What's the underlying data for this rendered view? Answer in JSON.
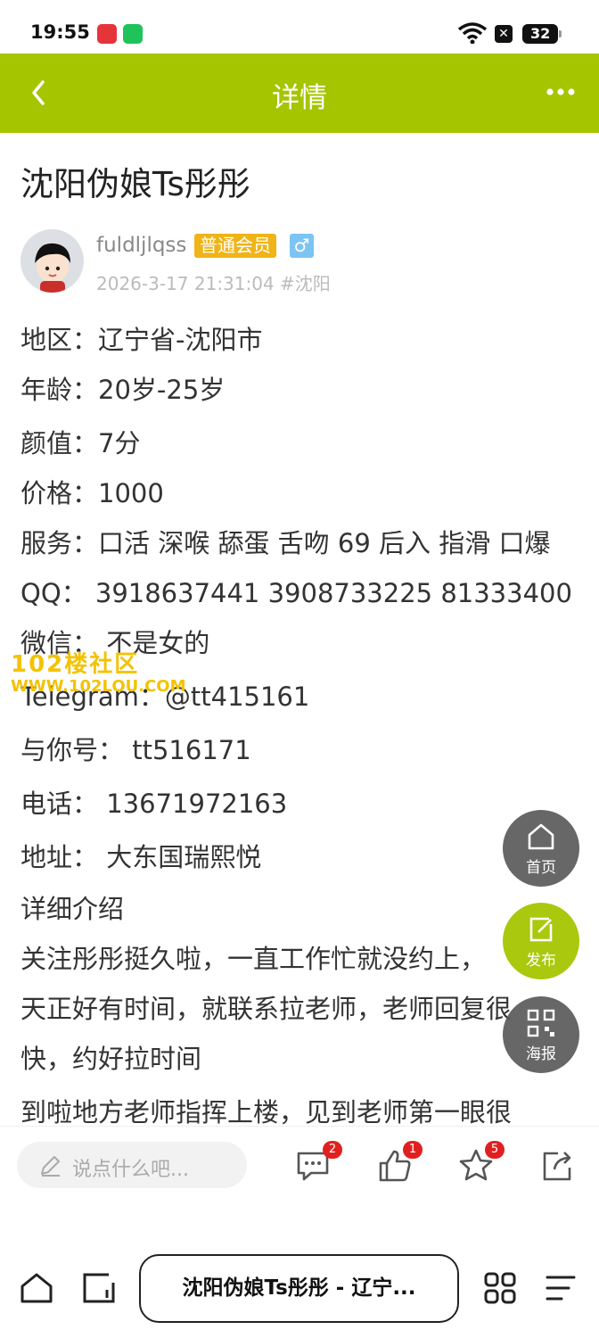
{
  "status_bar": {
    "time": "19:55",
    "battery": "32"
  },
  "header": {
    "title": "详情"
  },
  "post": {
    "title": "沈阳伪娘Ts彤彤",
    "author": "fuldljlqss",
    "member_badge": "普通会员",
    "gender_symbol": "♂",
    "timestamp": "2026-3-17 21:31:04",
    "tag": "#沈阳"
  },
  "details": [
    {
      "label": "地区：",
      "value": "辽宁省-沈阳市"
    },
    {
      "label": "年龄：",
      "value": "20岁-25岁"
    },
    {
      "label": "颜值：",
      "value": "7分"
    },
    {
      "label": "价格：",
      "value": "1000"
    },
    {
      "label": "服务：",
      "value": "口活 深喉 舔蛋 舌吻 69 后入 指滑 口爆"
    },
    {
      "label": "QQ：",
      "value": " 3918637441 3908733225 81333400"
    },
    {
      "label": "微信：",
      "value": " 不是女的"
    },
    {
      "label": "Telegram：",
      "value": "@tt415161"
    },
    {
      "label": "与你号：",
      "value": " tt516171"
    },
    {
      "label": "电话：",
      "value": " 13671972163"
    },
    {
      "label": "地址：",
      "value": " 大东国瑞熙悦"
    }
  ],
  "intro": {
    "heading": "详细介绍",
    "lines": [
      "关注彤彤挺久啦，一直工作忙就没约上，",
      "天正好有时间，就联系拉老师，老师回复很",
      "快，约好拉时间",
      "到啦地方老师指挥上楼，见到老师第一眼很"
    ]
  },
  "watermark": {
    "line1": "102楼社区",
    "line2": "WWW.102LOU.COM"
  },
  "floating": {
    "home": "首页",
    "post": "发布",
    "poster": "海报"
  },
  "comment_bar": {
    "placeholder": "说点什么吧...",
    "comments_count": "2",
    "likes_count": "1",
    "favorites_count": "5"
  },
  "browser": {
    "tab_title": "沈阳伪娘Ts彤彤 - 辽宁..."
  }
}
